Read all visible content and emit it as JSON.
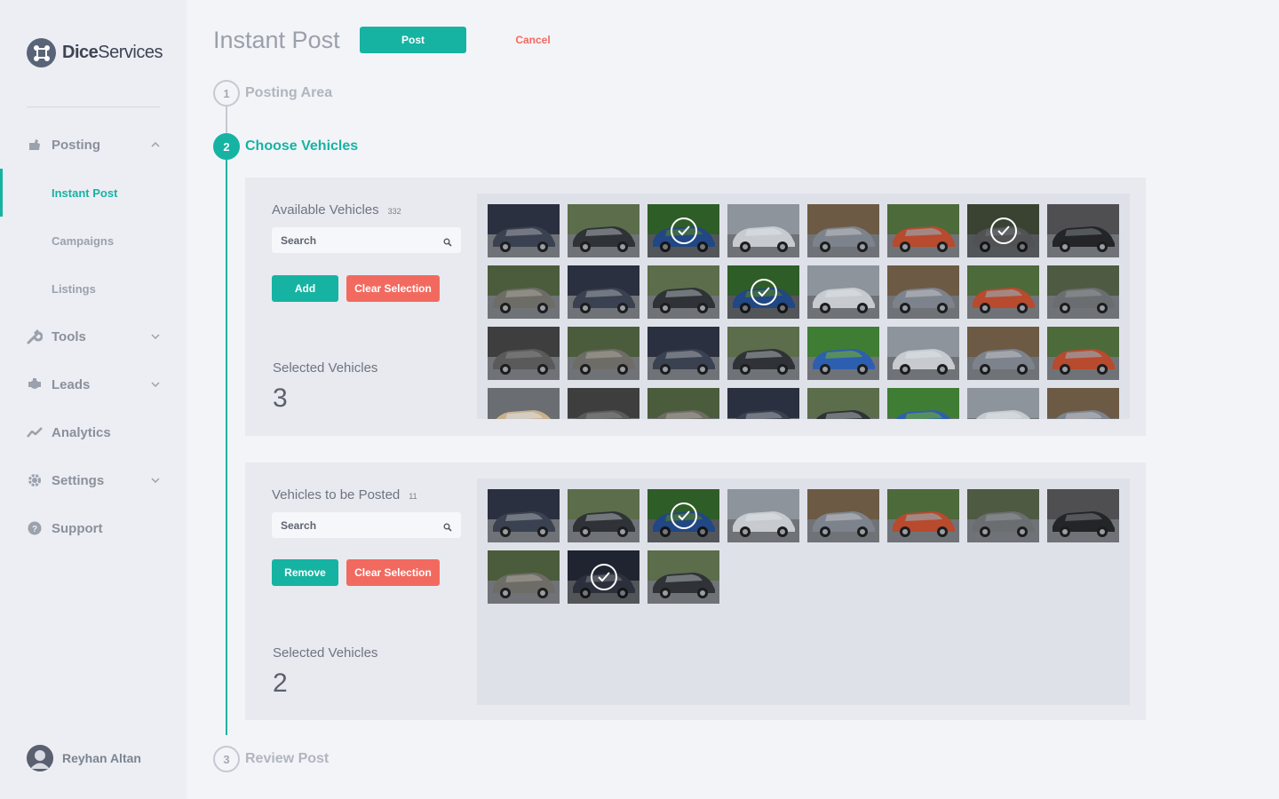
{
  "brand": {
    "name_bold": "Dice",
    "name_light": "Services"
  },
  "sidebar": {
    "items": [
      {
        "label": "Posting",
        "icon": "posting-icon",
        "expanded": true
      },
      {
        "label": "Tools",
        "icon": "wrench-icon",
        "expanded": false
      },
      {
        "label": "Leads",
        "icon": "leads-icon",
        "expanded": false
      },
      {
        "label": "Analytics",
        "icon": "analytics-icon"
      },
      {
        "label": "Settings",
        "icon": "gear-icon",
        "expanded": false
      },
      {
        "label": "Support",
        "icon": "help-icon"
      }
    ],
    "sub_items": [
      {
        "label": "Instant Post",
        "active": true
      },
      {
        "label": "Campaigns"
      },
      {
        "label": "Listings"
      }
    ],
    "user": {
      "name": "Reyhan Altan"
    }
  },
  "header": {
    "title": "Instant Post",
    "post_label": "Post",
    "cancel_label": "Cancel"
  },
  "steps": [
    {
      "number": "1",
      "label": "Posting Area"
    },
    {
      "number": "2",
      "label": "Choose Vehicles"
    },
    {
      "number": "3",
      "label": "Review Post"
    }
  ],
  "available": {
    "title": "Available Vehicles",
    "count": "332",
    "search_placeholder": "Search",
    "add_label": "Add",
    "clear_label": "Clear Selection",
    "selected_label": "Selected Vehicles",
    "selected_count": "3"
  },
  "to_post": {
    "title": "Vehicles to be Posted",
    "count": "11",
    "search_placeholder": "Search",
    "remove_label": "Remove",
    "clear_label": "Clear Selection",
    "selected_label": "Selected Vehicles",
    "selected_count": "2"
  },
  "colors": {
    "accent": "#16b3a2",
    "danger": "#f26a5f",
    "sidebar_bg": "#eceef4",
    "page_bg": "#f3f4f8"
  }
}
